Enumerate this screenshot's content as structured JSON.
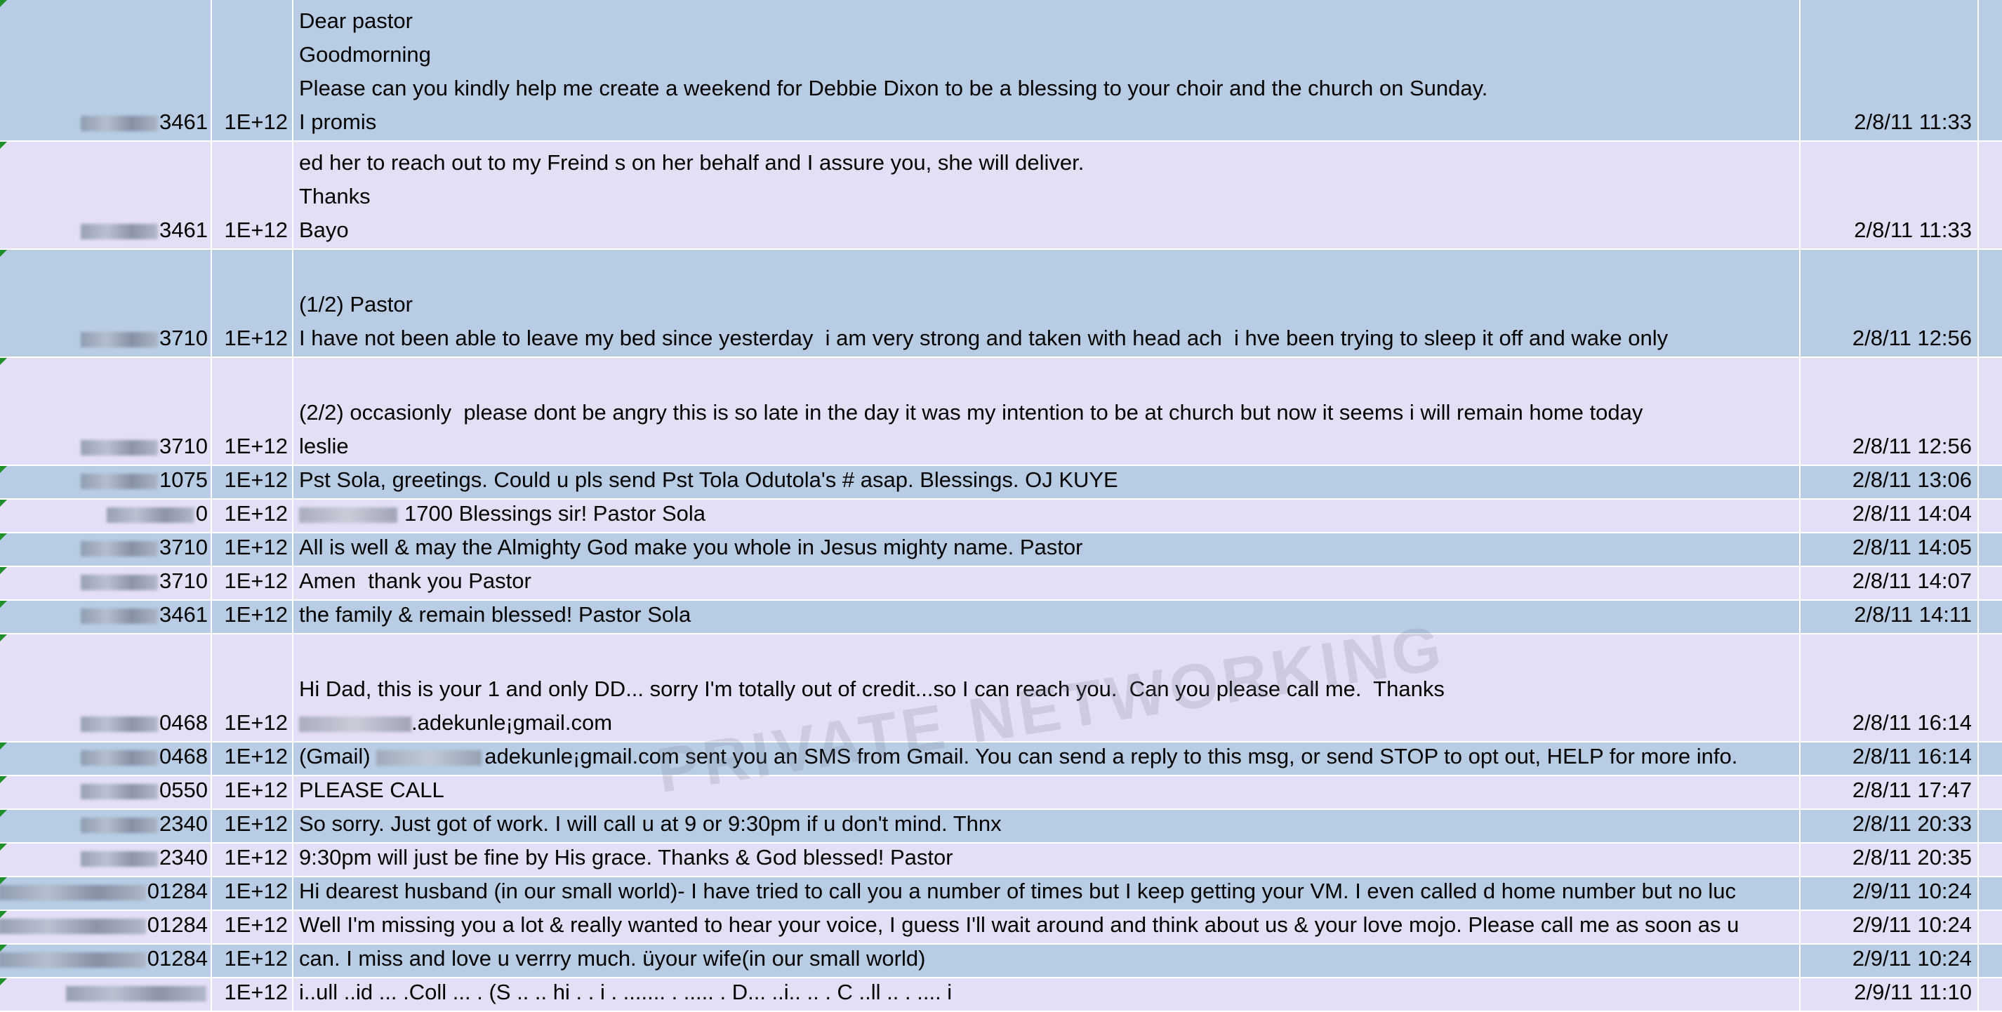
{
  "rows": [
    {
      "phone": "3461",
      "num": "1E+12",
      "lines": [
        "Dear pastor",
        "Goodmorning",
        "Please can you kindly help me create a weekend for Debbie Dixon to be a blessing to your choir and the church on Sunday.",
        "I promis"
      ],
      "date": "2/8/11 11:33"
    },
    {
      "phone": "3461",
      "num": "1E+12",
      "lines": [
        "ed her to reach out to my Freind s on her behalf and I assure you, she will deliver.",
        "Thanks",
        "Bayo"
      ],
      "date": "2/8/11 11:33"
    },
    {
      "phone": "3710",
      "num": "1E+12",
      "lines": [
        "(1/2) Pastor",
        "I have not been able to leave my bed since yesterday  i am very strong and taken with head ach  i hve been trying to sleep it off and wake only"
      ],
      "date": "2/8/11 12:56"
    },
    {
      "phone": "3710",
      "num": "1E+12",
      "lines": [
        "(2/2) occasionly  please dont be angry this is so late in the day it was my intention to be at church but now it seems i will remain home today",
        "leslie"
      ],
      "date": "2/8/11 12:56"
    },
    {
      "phone": "1075",
      "num": "1E+12",
      "lines": [
        "Pst Sola, greetings. Could u pls send Pst Tola Odutola's # asap. Blessings. OJ KUYE"
      ],
      "date": "2/8/11 13:06"
    },
    {
      "phone": "0",
      "num": "1E+12",
      "lines": [
        "1700 Blessings sir! Pastor Sola"
      ],
      "date": "2/8/11 14:04"
    },
    {
      "phone": "3710",
      "num": "1E+12",
      "lines": [
        "All is well & may the Almighty God make you whole in Jesus mighty name. Pastor"
      ],
      "date": "2/8/11 14:05"
    },
    {
      "phone": "3710",
      "num": "1E+12",
      "lines": [
        "Amen  thank you Pastor"
      ],
      "date": "2/8/11 14:07"
    },
    {
      "phone": "3461",
      "num": "1E+12",
      "lines": [
        "the family & remain blessed! Pastor Sola"
      ],
      "date": "2/8/11 14:11"
    },
    {
      "phone": "0468",
      "num": "1E+12",
      "lines": [
        "Hi Dad, this is your 1 and only DD... sorry I'm totally out of credit...so I can reach you.  Can you please call me.  Thanks",
        ".adekunle¡gmail.com"
      ],
      "date": "2/8/11 16:14"
    },
    {
      "phone": "0468",
      "num": "1E+12",
      "lines": [
        "(Gmail) ",
        "adekunle¡gmail.com sent you an SMS from Gmail. You can send a reply to this msg, or send STOP to opt out, HELP for more info."
      ],
      "date": "2/8/11 16:14"
    },
    {
      "phone": "0550",
      "num": "1E+12",
      "lines": [
        "PLEASE CALL"
      ],
      "date": "2/8/11 17:47"
    },
    {
      "phone": "2340",
      "num": "1E+12",
      "lines": [
        "So sorry. Just got of work. I will call u at 9 or 9:30pm if u don't mind. Thnx"
      ],
      "date": "2/8/11 20:33"
    },
    {
      "phone": "2340",
      "num": "1E+12",
      "lines": [
        "9:30pm will just be fine by His grace. Thanks & God blessed! Pastor"
      ],
      "date": "2/8/11 20:35"
    },
    {
      "phone": "01284",
      "num": "1E+12",
      "lines": [
        "Hi dearest husband (in our small world)- I have tried to call you a number of times but I keep getting your VM. I even called d home number but no luc"
      ],
      "date": "2/9/11 10:24"
    },
    {
      "phone": "01284",
      "num": "1E+12",
      "lines": [
        "Well I'm missing you a lot & really wanted to hear your voice, I guess I'll wait around and think about us & your love mojo. Please call me as soon as u"
      ],
      "date": "2/9/11 10:24"
    },
    {
      "phone": "01284",
      "num": "1E+12",
      "lines": [
        "can. I miss and love u verrry much. üyour wife(in our small world)"
      ],
      "date": "2/9/11 10:24"
    },
    {
      "phone": "",
      "num": "1E+12",
      "lines": [
        "i..ull ..id ... .Coll ... . (S .. .. hi . . i . ....... . ..... . D... ..i.. .. . C ..ll .. . .... i"
      ],
      "date": "2/9/11 11:10"
    }
  ],
  "watermark": "PRIVATE NETWORKING"
}
